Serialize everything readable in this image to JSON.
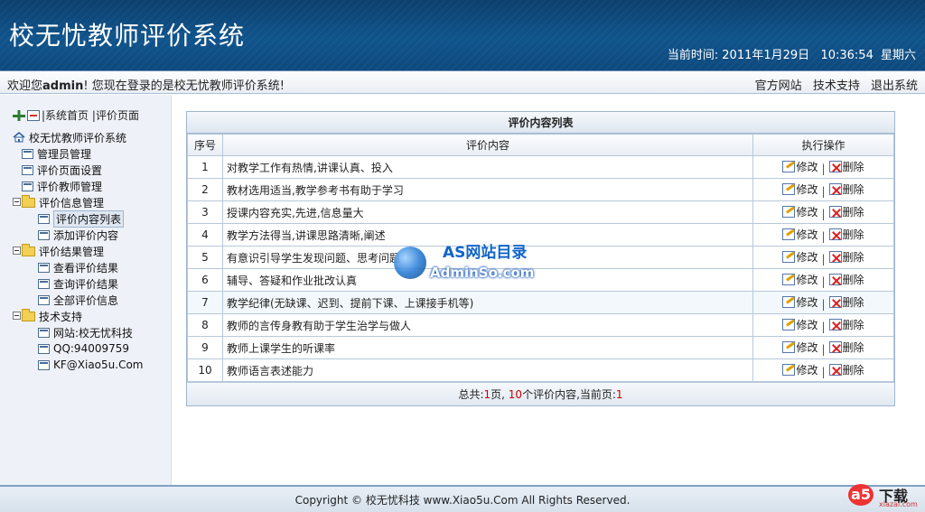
{
  "header": {
    "app_title": "校无忧教师评价系统",
    "clock_label": "当前时间:",
    "date": "2011年1月29日",
    "time": "10:36:54",
    "weekday": "星期六"
  },
  "welcome_bar": {
    "prefix": "欢迎您",
    "user": "admin",
    "suffix": "! 您现在登录的是校无忧教师评价系统!",
    "links": [
      "官方网站",
      "技术支持",
      "退出系统"
    ]
  },
  "sidebar": {
    "top_links": [
      "系统首页",
      "评价页面"
    ],
    "root": "校无忧教师评价系统",
    "items": [
      {
        "label": "管理员管理",
        "level": 1,
        "kind": "doc"
      },
      {
        "label": "评价页面设置",
        "level": 1,
        "kind": "doc"
      },
      {
        "label": "评价教师管理",
        "level": 1,
        "kind": "doc"
      },
      {
        "label": "评价信息管理",
        "level": 1,
        "kind": "folder"
      },
      {
        "label": "评价内容列表",
        "level": 2,
        "kind": "doc",
        "active": true
      },
      {
        "label": "添加评价内容",
        "level": 2,
        "kind": "doc"
      },
      {
        "label": "评价结果管理",
        "level": 1,
        "kind": "folder"
      },
      {
        "label": "查看评价结果",
        "level": 2,
        "kind": "doc"
      },
      {
        "label": "查询评价结果",
        "level": 2,
        "kind": "doc"
      },
      {
        "label": "全部评价信息",
        "level": 2,
        "kind": "doc"
      },
      {
        "label": "技术支持",
        "level": 1,
        "kind": "folder"
      },
      {
        "label": "网站:校无忧科技",
        "level": 2,
        "kind": "doc"
      },
      {
        "label": "QQ:94009759",
        "level": 2,
        "kind": "doc"
      },
      {
        "label": "KF@Xiao5u.Com",
        "level": 2,
        "kind": "doc"
      }
    ]
  },
  "table": {
    "caption": "评价内容列表",
    "columns": [
      "序号",
      "评价内容",
      "执行操作"
    ],
    "edit_label": "修改",
    "delete_label": "删除",
    "rows": [
      {
        "no": "1",
        "content": "对教学工作有热情,讲课认真、投入"
      },
      {
        "no": "2",
        "content": "教材选用适当,教学参考书有助于学习"
      },
      {
        "no": "3",
        "content": "授课内容充实,先进,信息量大"
      },
      {
        "no": "4",
        "content": "教学方法得当,讲课思路清晰,阐述"
      },
      {
        "no": "5",
        "content": "有意识引导学生发现问题、思考问题"
      },
      {
        "no": "6",
        "content": "辅导、答疑和作业批改认真"
      },
      {
        "no": "7",
        "content": "教学纪律(无缺课、迟到、提前下课、上课接手机等)"
      },
      {
        "no": "8",
        "content": "教师的言传身教有助于学生治学与做人"
      },
      {
        "no": "9",
        "content": "教师上课学生的听课率"
      },
      {
        "no": "10",
        "content": "教师语言表述能力"
      }
    ],
    "footer": {
      "total_label": "总共:",
      "pages": "1",
      "pages_unit": "页,",
      "items": "10",
      "items_unit": "个评价内容,当前页:",
      "current": "1"
    }
  },
  "watermark": {
    "title": "AS网站目录",
    "sub": "AdminSo.com"
  },
  "footer": {
    "copyright": "Copyright © 校无忧科技  www.Xiao5u.Com All Rights Reserved."
  },
  "corner_logo": {
    "mark": "a5",
    "text": "下载",
    "sub": "xiazai.com"
  }
}
